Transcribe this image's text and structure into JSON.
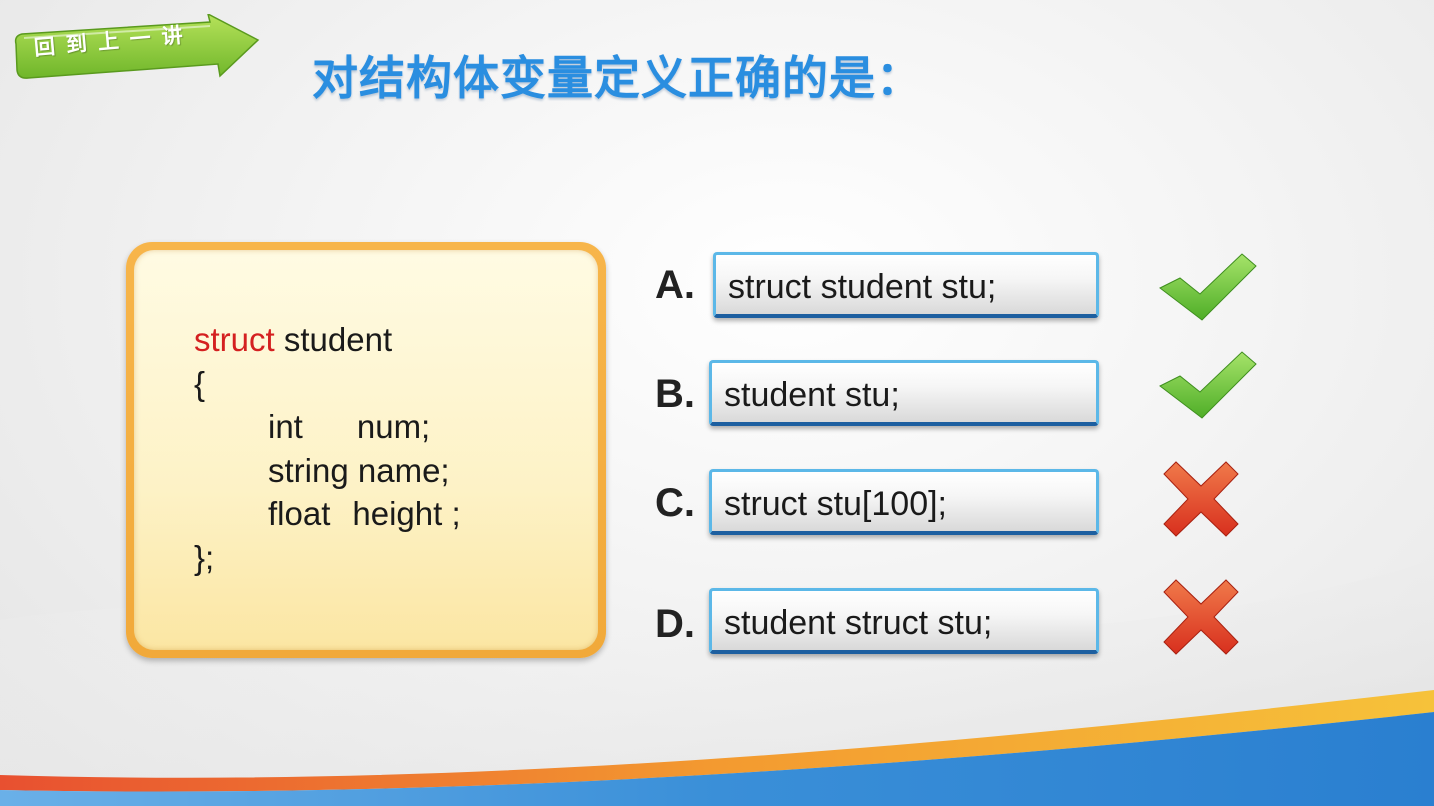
{
  "back_button": {
    "label": "回到上一讲"
  },
  "title": "对结构体变量定义正确的是：",
  "code": {
    "keyword": "struct",
    "name": "student",
    "open_brace": "{",
    "fields": [
      {
        "type": "int",
        "name": "num;"
      },
      {
        "type": "string",
        "name": "name;"
      },
      {
        "type": "float",
        "name": "height ;"
      }
    ],
    "close_brace": "};"
  },
  "options": [
    {
      "letter": "A.",
      "text": "struct student stu;",
      "result": "correct",
      "icon": "checkmark-icon"
    },
    {
      "letter": "B.",
      "text": "student stu;",
      "result": "correct",
      "icon": "checkmark-icon"
    },
    {
      "letter": "C.",
      "text": "struct stu[100];",
      "result": "wrong",
      "icon": "cross-icon"
    },
    {
      "letter": "D.",
      "text": "student struct stu;",
      "result": "wrong",
      "icon": "cross-icon"
    }
  ],
  "colors": {
    "title": "#2a8ee0",
    "keyword": "#d42020",
    "check": "#5fbf3a",
    "cross": "#e0442a",
    "panel_border": "#f1a93a",
    "option_border": "#5cb8e8"
  }
}
